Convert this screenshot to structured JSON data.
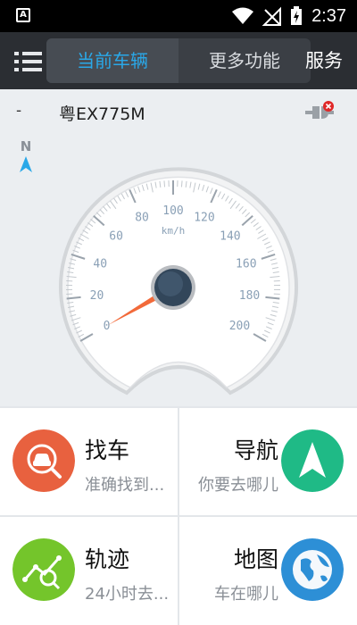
{
  "statusbar": {
    "time": "2:37",
    "app_badge": "A"
  },
  "header": {
    "tabs": [
      {
        "label": "当前车辆",
        "active": true
      },
      {
        "label": "更多功能",
        "active": false
      }
    ],
    "service_label": "服务"
  },
  "vehicle": {
    "status_dash": "-",
    "plate": "粤EX775M",
    "compass_label": "N"
  },
  "speedometer": {
    "unit": "km/h",
    "ticks": [
      "0",
      "20",
      "40",
      "60",
      "80",
      "100",
      "120",
      "140",
      "160",
      "180",
      "200"
    ],
    "current_speed": 0
  },
  "features": [
    {
      "title": "找车",
      "subtitle": "准确找到...",
      "icon": "car-search-icon",
      "color": "#e8613f"
    },
    {
      "title": "导航",
      "subtitle": "你要去哪儿",
      "icon": "navigation-arrow-icon",
      "color": "#1fba86"
    },
    {
      "title": "轨迹",
      "subtitle": "24小时去...",
      "icon": "track-icon",
      "color": "#74c52b"
    },
    {
      "title": "地图",
      "subtitle": "车在哪儿",
      "icon": "globe-icon",
      "color": "#2d8fd6"
    }
  ],
  "colors": {
    "header_bg": "#2b2e33",
    "tab_active_text": "#2aa8e8",
    "needle": "#f26a3a"
  }
}
